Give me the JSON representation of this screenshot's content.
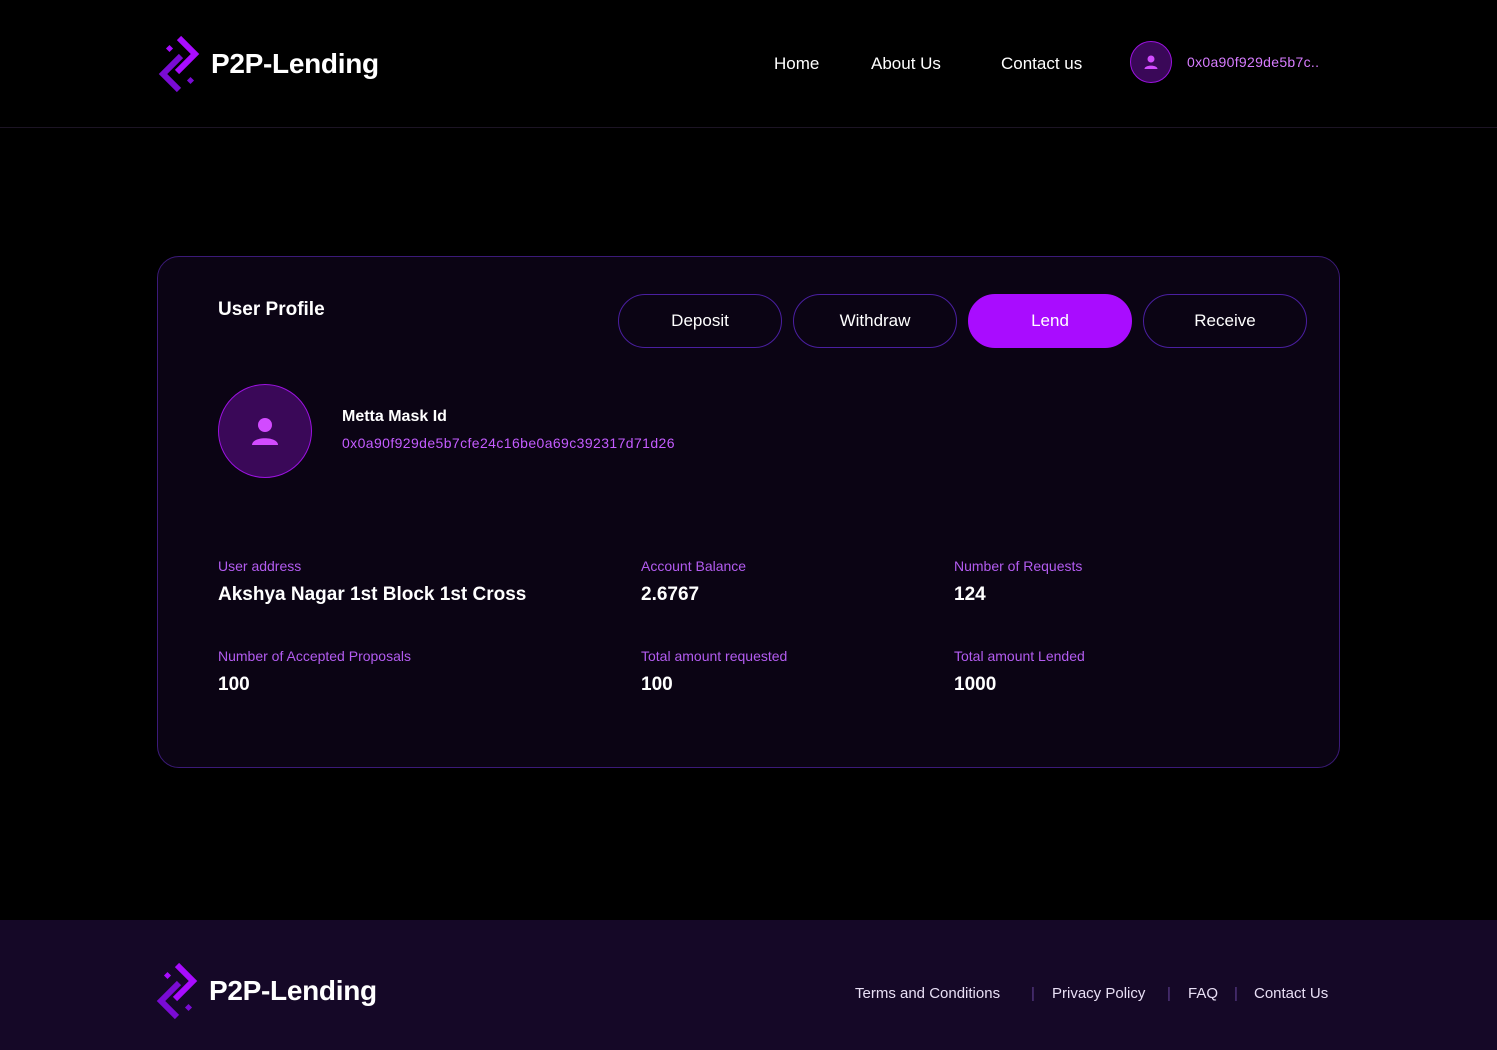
{
  "brand": {
    "name": "P2P-Lending",
    "accent_color": "#a90cff"
  },
  "header": {
    "nav": {
      "home": "Home",
      "about": "About Us",
      "contact": "Contact us"
    },
    "wallet_short": "0x0a90f929de5b7c.."
  },
  "profile": {
    "title": "User Profile",
    "actions": {
      "deposit": "Deposit",
      "withdraw": "Withdraw",
      "lend": "Lend",
      "receive": "Receive",
      "active": "lend"
    },
    "metamask_label": "Metta Mask Id",
    "metamask_id": "0x0a90f929de5b7cfe24c16be0a69c392317d71d26",
    "stats": {
      "user_address": {
        "label": "User address",
        "value": "Akshya Nagar 1st Block 1st Cross"
      },
      "account_balance": {
        "label": "Account Balance",
        "value": "2.6767"
      },
      "num_requests": {
        "label": "Number of Requests",
        "value": "124"
      },
      "accepted_proposals": {
        "label": "Number of Accepted Proposals",
        "value": "100"
      },
      "total_requested": {
        "label": "Total amount requested",
        "value": "100"
      },
      "total_lended": {
        "label": "Total amount Lended",
        "value": "1000"
      }
    }
  },
  "footer": {
    "links": {
      "terms": "Terms and Conditions",
      "privacy": "Privacy Policy",
      "faq": "FAQ",
      "contact": "Contact Us"
    },
    "separator": "|"
  },
  "icons": {
    "logo": "chain-link-logo-icon",
    "user": "user-icon"
  }
}
